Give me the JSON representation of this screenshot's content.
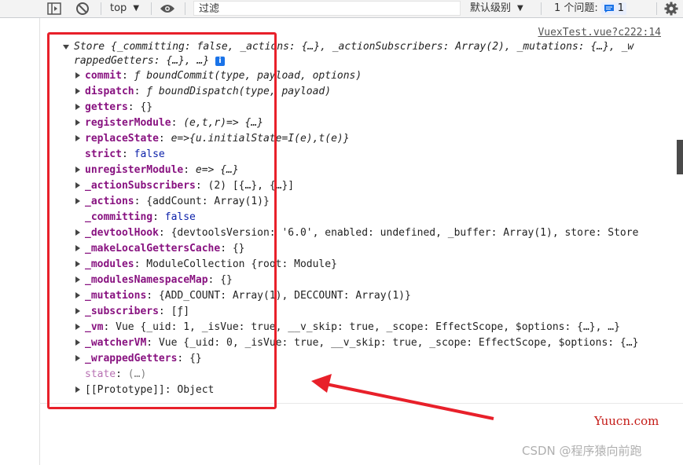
{
  "toolbar": {
    "context": "top",
    "filter_placeholder": "过滤",
    "levels": "默认级别",
    "issues_label": "1 个问题:",
    "issues_count": "1"
  },
  "console": {
    "source": "VuexTest.vue?c222:14",
    "header_line1": "Store {_committing: false, _actions: {…}, _actionSubscribers: Array(2), _mutations: {…}, _w",
    "header_line2": "rappedGetters: {…}, …}",
    "info_glyph": "i",
    "props": [
      {
        "key": "commit",
        "sep": ": ",
        "val": "ƒ boundCommit(type, payload, options)",
        "expandable": true
      },
      {
        "key": "dispatch",
        "sep": ": ",
        "val": "ƒ boundDispatch(type, payload)",
        "expandable": true
      },
      {
        "key": "getters",
        "sep": ": ",
        "val": "{}",
        "expandable": true
      },
      {
        "key": "registerModule",
        "sep": ": ",
        "val": "(e,t,r)=> {…}",
        "expandable": true
      },
      {
        "key": "replaceState",
        "sep": ": ",
        "val": "e=>{u.initialState=I(e),t(e)}",
        "expandable": true
      },
      {
        "key": "strict",
        "sep": ": ",
        "val": "false",
        "expandable": false
      },
      {
        "key": "unregisterModule",
        "sep": ": ",
        "val": "e=> {…}",
        "expandable": true
      },
      {
        "key": "_actionSubscribers",
        "sep": ": ",
        "val": "(2) [{…}, {…}]",
        "expandable": true
      },
      {
        "key": "_actions",
        "sep": ": ",
        "val": "{addCount: Array(1)}",
        "expandable": true
      },
      {
        "key": "_committing",
        "sep": ": ",
        "val": "false",
        "expandable": false
      },
      {
        "key": "_devtoolHook",
        "sep": ": ",
        "val": "{devtoolsVersion: '6.0', enabled: undefined, _buffer: Array(1), store: Store",
        "expandable": true
      },
      {
        "key": "_makeLocalGettersCache",
        "sep": ": ",
        "val": "{}",
        "expandable": true
      },
      {
        "key": "_modules",
        "sep": ": ",
        "val": "ModuleCollection {root: Module}",
        "expandable": true
      },
      {
        "key": "_modulesNamespaceMap",
        "sep": ": ",
        "val": "{}",
        "expandable": true
      },
      {
        "key": "_mutations",
        "sep": ": ",
        "val": "{ADD_COUNT: Array(1), DECCOUNT: Array(1)}",
        "expandable": true
      },
      {
        "key": "_subscribers",
        "sep": ": ",
        "val": "[ƒ]",
        "expandable": true
      },
      {
        "key": "_vm",
        "sep": ": ",
        "val": "Vue {_uid: 1, _isVue: true, __v_skip: true, _scope: EffectScope, $options: {…}, …}",
        "expandable": true
      },
      {
        "key": "_watcherVM",
        "sep": ": ",
        "val": "Vue {_uid: 0, _isVue: true, __v_skip: true, _scope: EffectScope, $options: {…}",
        "expandable": true
      },
      {
        "key": "_wrappedGetters",
        "sep": ": ",
        "val": "{}",
        "expandable": true
      },
      {
        "key": "state",
        "sep": ": ",
        "val": "(…)",
        "expandable": false,
        "dim": true
      },
      {
        "key": "[[Prototype]]",
        "sep": ": ",
        "val": "Object",
        "expandable": true,
        "plain": true
      }
    ]
  },
  "watermarks": {
    "site": "Yuucn.com",
    "csdn": "CSDN @程序猿向前跑"
  },
  "colors": {
    "annotation": "#e8202a",
    "property_key": "#881280",
    "keyword": "#0d22aa",
    "string": "#c41a16"
  }
}
